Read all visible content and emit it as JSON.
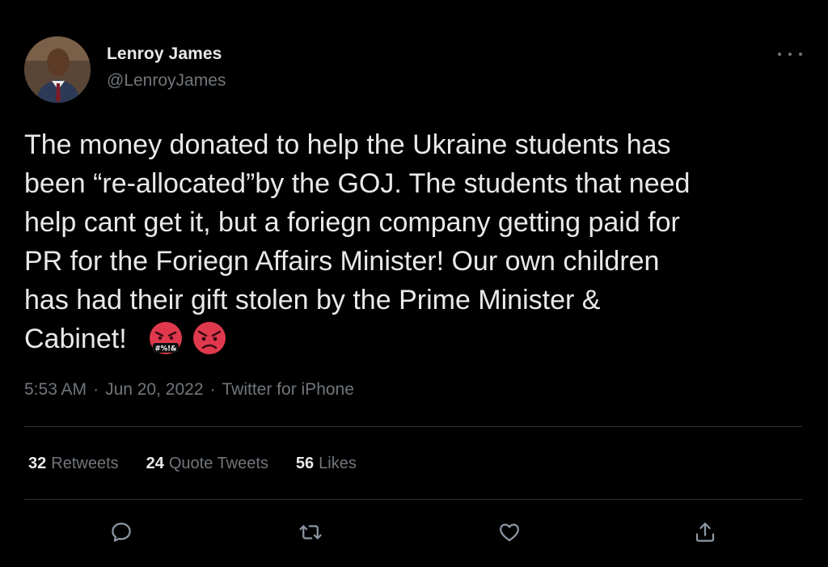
{
  "author": {
    "name": "Lenroy James",
    "handle": "@LenroyJames"
  },
  "tweet": {
    "text": "The money donated to help the Ukraine students has\nbeen “re-allocated”by the GOJ. The students that need\nhelp cant get it, but a foriegn company getting paid for\nPR for the Foriegn Affairs Minister! Our own children\nhas had their gift stolen by the Prime Minister &\nCabinet!",
    "emojis": [
      {
        "icon": "angry-face-with-symbols-icon",
        "symbols": "#%!&"
      },
      {
        "icon": "angry-face-icon"
      }
    ]
  },
  "meta": {
    "time": "5:53 AM",
    "date": "Jun 20, 2022",
    "source": "Twitter for iPhone",
    "separator": "·"
  },
  "stats": [
    {
      "count": "32",
      "label": "Retweets"
    },
    {
      "count": "24",
      "label": "Quote Tweets"
    },
    {
      "count": "56",
      "label": "Likes"
    }
  ],
  "actions": [
    "reply-icon",
    "retweet-icon",
    "like-icon",
    "share-icon"
  ],
  "colors": {
    "background": "#000000",
    "text": "#e7e9ea",
    "secondary": "#71767b",
    "divider": "#2f3336",
    "emoji_red": "#e0394e"
  }
}
